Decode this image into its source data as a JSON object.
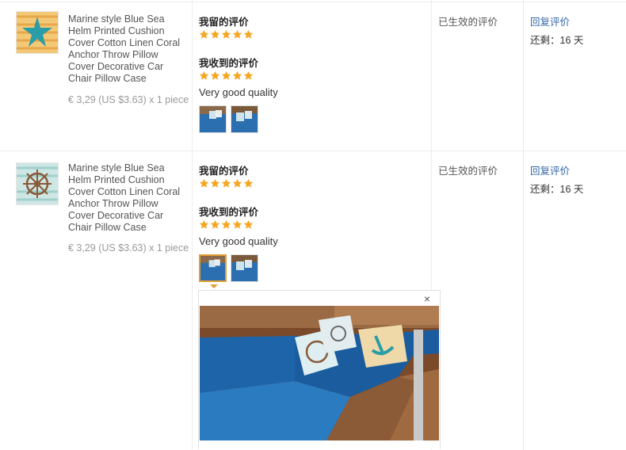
{
  "reviews": [
    {
      "product_name": "Marine style Blue Sea Helm Printed Cushion Cover Cotton Linen Coral Anchor Throw Pillow Cover Decorative Car Chair Pillow Case",
      "price": "€ 3,29 (US $3.63) x 1 piece",
      "my_review_label": "我留的评价",
      "my_rating": 5,
      "received_label": "我收到的评价",
      "received_rating": 5,
      "comment": "Very good quality",
      "status": "已生效的评价",
      "reply_link": "回复评价",
      "remaining": "还剩：16 天"
    },
    {
      "product_name": "Marine style Blue Sea Helm Printed Cushion Cover Cotton Linen Coral Anchor Throw Pillow Cover Decorative Car Chair Pillow Case",
      "price": "€ 3,29 (US $3.63) x 1 piece",
      "my_review_label": "我留的评价",
      "my_rating": 5,
      "received_label": "我收到的评价",
      "received_rating": 5,
      "comment": "Very good quality",
      "status": "已生效的评价",
      "reply_link": "回复评价",
      "remaining": "还剩：16 天"
    }
  ],
  "preview": {
    "close_glyph": "×"
  },
  "colors": {
    "star": "#f5a623",
    "link": "#3366aa",
    "active_border": "#e4a038"
  },
  "icons": [
    "starfish-icon",
    "helm-icon",
    "star-icon",
    "close-icon"
  ]
}
